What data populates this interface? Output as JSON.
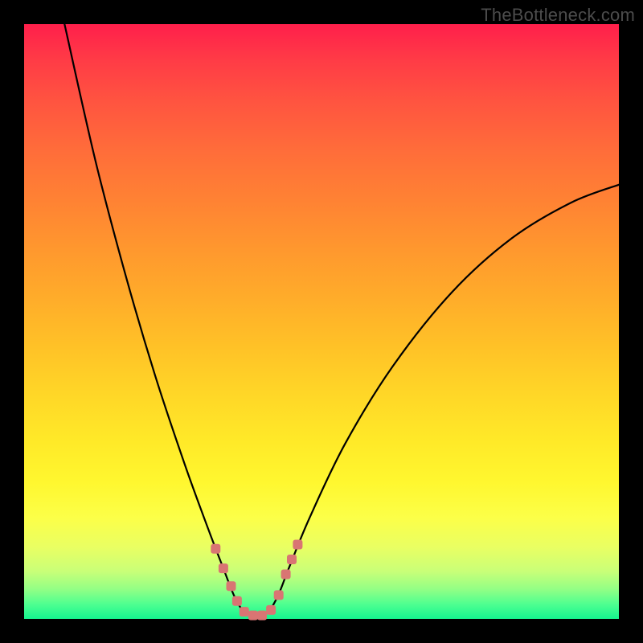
{
  "watermark": "TheBottleneck.com",
  "chart_data": {
    "type": "line",
    "title": "",
    "xlabel": "",
    "ylabel": "",
    "xlim": [
      0,
      1
    ],
    "ylim": [
      0,
      1
    ],
    "description": "V-shaped bottleneck curve with minimum near x≈0.39; left branch steep from top-left, right branch shallower rising toward right edge at y≈0.73.",
    "series": [
      {
        "name": "bottleneck-curve",
        "points": [
          {
            "x": 0.068,
            "y": 1.0
          },
          {
            "x": 0.12,
            "y": 0.77
          },
          {
            "x": 0.17,
            "y": 0.58
          },
          {
            "x": 0.22,
            "y": 0.41
          },
          {
            "x": 0.27,
            "y": 0.26
          },
          {
            "x": 0.31,
            "y": 0.15
          },
          {
            "x": 0.335,
            "y": 0.085
          },
          {
            "x": 0.355,
            "y": 0.035
          },
          {
            "x": 0.375,
            "y": 0.008
          },
          {
            "x": 0.405,
            "y": 0.008
          },
          {
            "x": 0.425,
            "y": 0.035
          },
          {
            "x": 0.445,
            "y": 0.085
          },
          {
            "x": 0.48,
            "y": 0.17
          },
          {
            "x": 0.54,
            "y": 0.295
          },
          {
            "x": 0.62,
            "y": 0.425
          },
          {
            "x": 0.72,
            "y": 0.55
          },
          {
            "x": 0.82,
            "y": 0.64
          },
          {
            "x": 0.92,
            "y": 0.7
          },
          {
            "x": 1.0,
            "y": 0.73
          }
        ]
      }
    ],
    "markers": {
      "name": "highlight-points",
      "color": "#d97573",
      "points": [
        {
          "x": 0.322,
          "y": 0.118
        },
        {
          "x": 0.335,
          "y": 0.085
        },
        {
          "x": 0.348,
          "y": 0.055
        },
        {
          "x": 0.358,
          "y": 0.03
        },
        {
          "x": 0.37,
          "y": 0.012
        },
        {
          "x": 0.385,
          "y": 0.006
        },
        {
          "x": 0.4,
          "y": 0.006
        },
        {
          "x": 0.415,
          "y": 0.015
        },
        {
          "x": 0.428,
          "y": 0.04
        },
        {
          "x": 0.44,
          "y": 0.075
        },
        {
          "x": 0.45,
          "y": 0.1
        },
        {
          "x": 0.46,
          "y": 0.125
        }
      ]
    }
  }
}
